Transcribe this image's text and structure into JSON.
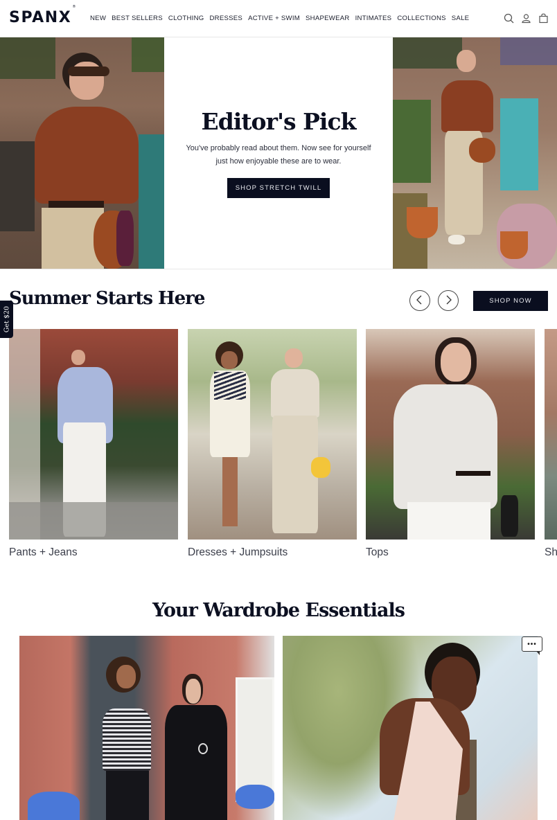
{
  "header": {
    "logo": "SPANX",
    "logo_mark": "®",
    "nav": [
      "NEW",
      "BEST SELLERS",
      "CLOTHING",
      "DRESSES",
      "ACTIVE + SWIM",
      "SHAPEWEAR",
      "INTIMATES",
      "COLLECTIONS",
      "SALE"
    ],
    "icons": [
      "search-icon",
      "account-icon",
      "bag-icon"
    ]
  },
  "hero": {
    "title": "Editor's Pick",
    "subtitle": "You've probably read about them. Now see for yourself just how enjoyable these are to wear.",
    "button_label": "SHOP STRETCH TWILL",
    "left_image_alt": "Woman in rust polo and khaki pants with brown handbag",
    "right_image_alt": "Woman in rust polo and khaki pants on brownstone steps"
  },
  "promo_tab": {
    "label": "Get $20"
  },
  "summer": {
    "title": "Summer Starts Here",
    "prev_icon": "chevron-left-icon",
    "next_icon": "chevron-right-icon",
    "shop_now_label": "SHOP NOW",
    "cards": [
      {
        "label": "Pants + Jeans",
        "image_alt": "Woman in blue shirt and white pants"
      },
      {
        "label": "Dresses + Jumpsuits",
        "image_alt": "Two women in cream outfits"
      },
      {
        "label": "Tops",
        "image_alt": "Woman in striped white shirt"
      },
      {
        "label": "Sh",
        "image_alt": "Partially visible card"
      }
    ]
  },
  "wardrobe": {
    "title": "Your Wardrobe Essentials",
    "images": [
      {
        "image_alt": "Two women in front of red brick building"
      },
      {
        "image_alt": "Woman in pale pink dress under palm tree"
      }
    ]
  },
  "chat": {
    "label": "•••"
  },
  "colors": {
    "primary_dark": "#0a0e1f",
    "text": "#0c1021",
    "background": "#ffffff"
  }
}
